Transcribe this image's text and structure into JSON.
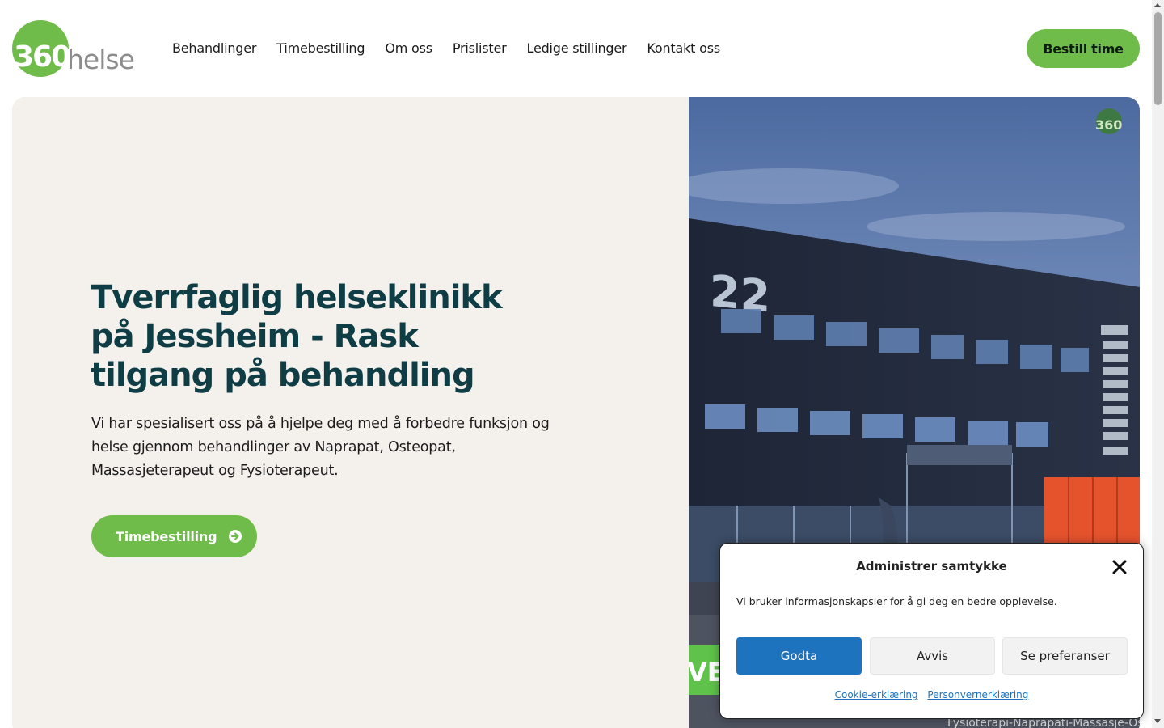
{
  "header": {
    "logo_text_number": "360",
    "logo_text_word": "helse",
    "nav": [
      {
        "label": "Behandlinger"
      },
      {
        "label": "Timebestilling"
      },
      {
        "label": "Om oss"
      },
      {
        "label": "Prislister"
      },
      {
        "label": "Ledige stillinger"
      },
      {
        "label": "Kontakt oss"
      }
    ],
    "book_button": "Bestill time"
  },
  "hero": {
    "title": "Tverrfaglig helseklinikk på Jessheim - Rask tilgang på behandling",
    "description": "Vi har spesialisert oss på å hjelpe deg med å forbedre funksjon og helse gjennom behandlinger av Naprapat, Osteopat, Massasjeterapeut og Fysioterapeut.",
    "cta": "Timebestilling",
    "image": {
      "building_number": "22",
      "banner_text": "VEL",
      "caption_text": "Fysioterapi-Naprapati-Massasje-Osteo"
    }
  },
  "cookie_banner": {
    "title": "Administrer samtykke",
    "message": "Vi bruker informasjonskapsler for å gi deg en bedre opplevelse.",
    "accept": "Godta",
    "deny": "Avvis",
    "preferences": "Se preferanser",
    "links": [
      {
        "label": "Cookie-erklæring"
      },
      {
        "label": "Personvernerklæring"
      }
    ]
  },
  "colors": {
    "brand_green": "#6fbc4b",
    "title_teal": "#0f3d45",
    "hero_bg": "#f4f1ec",
    "accept_blue": "#1e73be"
  },
  "icons": [
    "arrow-circle-right-icon",
    "close-icon"
  ]
}
